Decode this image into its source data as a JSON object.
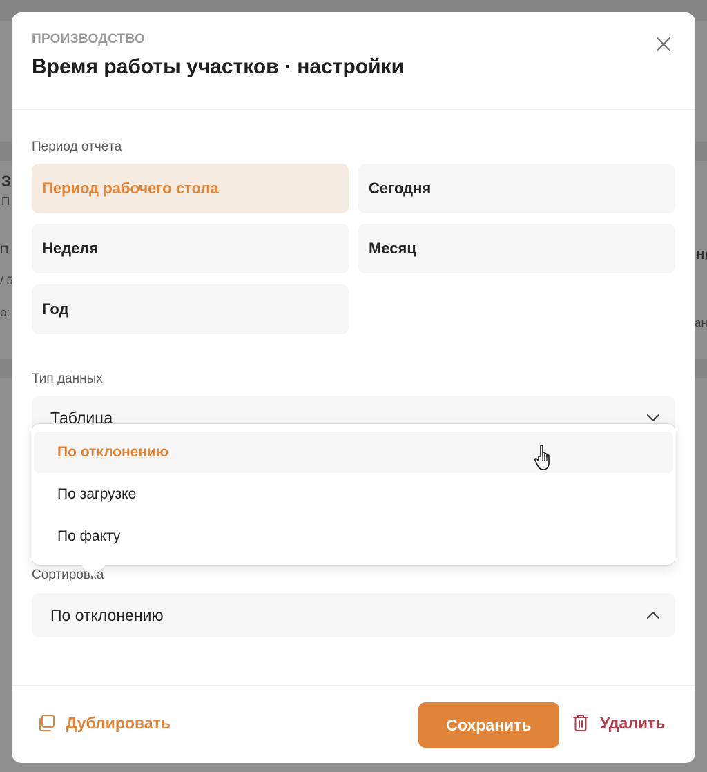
{
  "modal": {
    "eyebrow": "ПРОИЗВОДСТВО",
    "title": "Время работы участков · настройки"
  },
  "period": {
    "label": "Период отчёта",
    "options": [
      "Период рабочего стола",
      "Сегодня",
      "Неделя",
      "Месяц",
      "Год"
    ],
    "selected": "Период рабочего стола"
  },
  "data_type": {
    "label": "Тип данных",
    "value": "Таблица"
  },
  "dropdown": {
    "items": [
      "По отклонению",
      "По загрузке",
      "По факту"
    ],
    "hovered": "По отклонению"
  },
  "sorting": {
    "label": "Сортировка",
    "value": "По отклонению"
  },
  "footer": {
    "duplicate_label": "Дублировать",
    "save_label": "Сохранить",
    "delete_label": "Удалить"
  },
  "colors": {
    "accent": "#e0843a",
    "accent_bg": "#f6ebe1",
    "danger": "#b63d4c"
  },
  "icons": {
    "close": "close-icon",
    "chevron_down": "chevron-down-icon",
    "chevron_up": "chevron-up-icon",
    "duplicate": "duplicate-icon",
    "trash": "trash-icon",
    "cursor": "hand-cursor-icon"
  },
  "background": {
    "fragments": [
      "З",
      "П",
      "П",
      "/ 5",
      "о:",
      "н/",
      "ан"
    ]
  }
}
